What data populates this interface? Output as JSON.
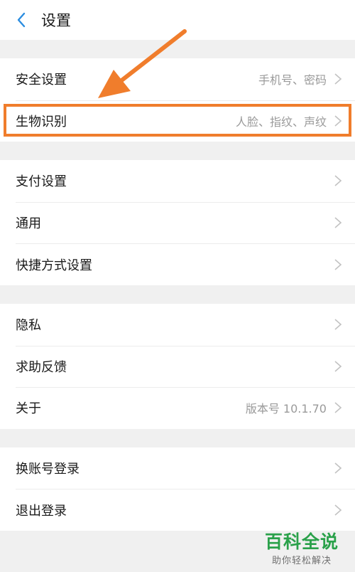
{
  "header": {
    "title": "设置",
    "back_icon": "chevron-left-icon"
  },
  "groups": [
    {
      "items": [
        {
          "label": "安全设置",
          "value": "手机号、密码"
        },
        {
          "label": "生物识别",
          "value": "人脸、指纹、声纹"
        }
      ]
    },
    {
      "items": [
        {
          "label": "支付设置",
          "value": ""
        },
        {
          "label": "通用",
          "value": ""
        },
        {
          "label": "快捷方式设置",
          "value": ""
        }
      ]
    },
    {
      "items": [
        {
          "label": "隐私",
          "value": ""
        },
        {
          "label": "求助反馈",
          "value": ""
        },
        {
          "label": "关于",
          "value": "版本号 10.1.70"
        }
      ]
    },
    {
      "items": [
        {
          "label": "换账号登录",
          "value": ""
        },
        {
          "label": "退出登录",
          "value": ""
        }
      ]
    }
  ],
  "watermark": {
    "title": "百科全说",
    "subtitle": "助你轻松解决"
  },
  "colors": {
    "accent": "#f07d2c",
    "back_icon": "#2b8de0",
    "watermark": "#2aa14a"
  }
}
